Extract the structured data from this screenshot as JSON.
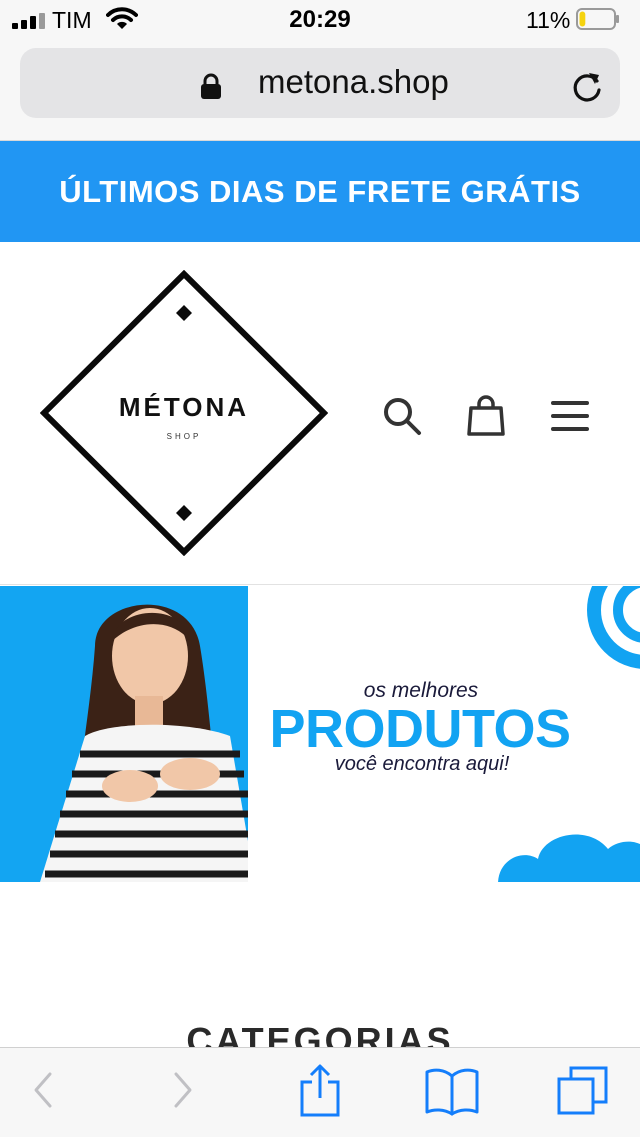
{
  "status_bar": {
    "carrier": "TIM",
    "time": "20:29",
    "battery_percent": "11%",
    "battery_level": 0.11,
    "icons": [
      "signal-icon",
      "wifi-icon",
      "battery-icon"
    ]
  },
  "browser": {
    "url": "metona.shop",
    "icons": [
      "lock-icon",
      "reload-icon"
    ]
  },
  "promo_bar": {
    "text": "ÚLTIMOS DIAS DE FRETE GRÁTIS"
  },
  "header": {
    "logo_title": "MÉTONA",
    "logo_subtitle": "SHOP",
    "icons": [
      "search-icon",
      "shopping-bag-icon",
      "menu-icon"
    ]
  },
  "banner": {
    "line1": "os melhores",
    "line2": "PRODUTOS",
    "line3": "você encontra aqui!",
    "colors": {
      "brand_blue": "#12a3f2"
    }
  },
  "section": {
    "title": "CATEGORIAS"
  },
  "toolbar": {
    "icons": [
      "back-icon",
      "forward-icon",
      "share-icon",
      "bookmarks-icon",
      "tabs-icon"
    ]
  },
  "colors": {
    "promo_background": "#2196f3",
    "ios_blue": "#147efb"
  }
}
